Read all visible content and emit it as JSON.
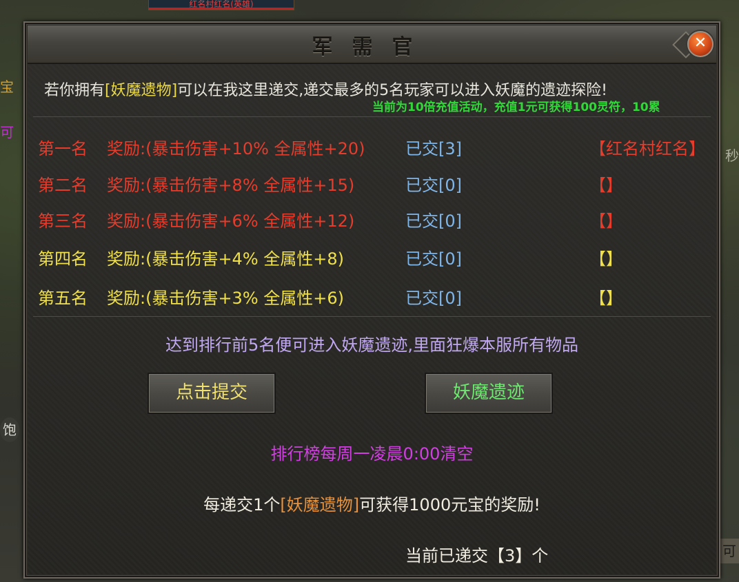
{
  "background": {
    "top_label": "红名村红名(英雄)",
    "left_texts": [
      "宝",
      "可",
      "饱"
    ],
    "right_text": "秒",
    "right_icon": "可"
  },
  "dialog": {
    "title": "军需官",
    "close_label": "✕"
  },
  "intro": {
    "prefix": "若你拥有",
    "item": "[妖魔遗物]",
    "suffix": "可以在我这里递交,递交最多的5名玩家可以进入妖魔的遗迹探险!"
  },
  "marquee": "当前为10倍充值活动，充值1元可获得100灵符，10累",
  "rankings": [
    {
      "rank": "第一名",
      "reward": "奖励:(暴击伤害+10% 全属性+20)",
      "count": "已交[3]",
      "player": "【红名村红名】",
      "color": "red"
    },
    {
      "rank": "第二名",
      "reward": "奖励:(暴击伤害+8% 全属性+15)",
      "count": "已交[0]",
      "player": "【】",
      "color": "red"
    },
    {
      "rank": "第三名",
      "reward": "奖励:(暴击伤害+6% 全属性+12)",
      "count": "已交[0]",
      "player": "【】",
      "color": "red"
    },
    {
      "rank": "第四名",
      "reward": "奖励:(暴击伤害+4% 全属性+8)",
      "count": "已交[0]",
      "player": "【】",
      "color": "yellow"
    },
    {
      "rank": "第五名",
      "reward": "奖励:(暴击伤害+3% 全属性+6)",
      "count": "已交[0]",
      "player": "【】",
      "color": "yellow"
    }
  ],
  "notice": "达到排行前5名便可进入妖魔遗迹,里面狂爆本服所有物品",
  "buttons": {
    "submit": "点击提交",
    "ruins": "妖魔遗迹"
  },
  "reset_note": "排行榜每周一凌晨0:00清空",
  "reward_note": {
    "prefix": "每递交1个",
    "item": "[妖魔遗物]",
    "suffix": "可获得1000元宝的奖励!"
  },
  "current": {
    "prefix": "当前已递交",
    "value": "【3】",
    "suffix": "个"
  },
  "colors": {
    "rank_red": "#e63c2c",
    "rank_yellow": "#f0e04a",
    "count_blue": "#7fb6ea",
    "notice_purple": "#c0a8f0",
    "reset_magenta": "#d040e0",
    "marquee_green": "#32d83a"
  }
}
